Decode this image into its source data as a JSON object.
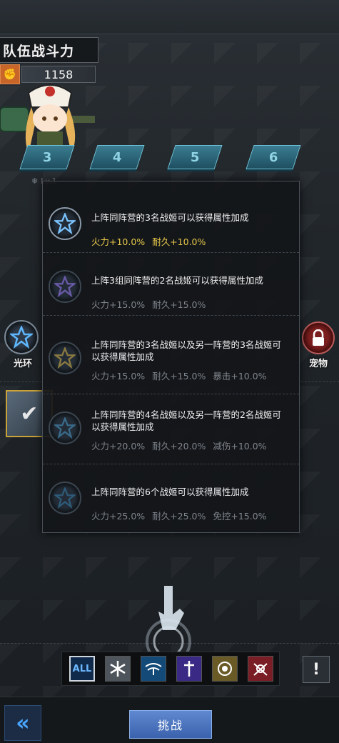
{
  "team": {
    "title": "队伍战斗力",
    "power": "1158"
  },
  "formation": {
    "slots": [
      "3",
      "4",
      "5",
      "6"
    ],
    "level_tag": "Lv.1"
  },
  "aura": {
    "label": "光环"
  },
  "pet": {
    "label": "宠物"
  },
  "popup": {
    "bonuses": [
      {
        "desc": "上阵同阵营的3名战姬可以获得属性加成",
        "stats": [
          "火力+10.0%",
          "耐久+10.0%"
        ],
        "active": true
      },
      {
        "desc": "上阵3组同阵营的2名战姬可以获得属性加成",
        "stats": [
          "火力+15.0%",
          "耐久+15.0%"
        ],
        "active": false
      },
      {
        "desc": "上阵同阵营的3名战姬以及另一阵营的3名战姬可以获得属性加成",
        "stats": [
          "火力+15.0%",
          "耐久+15.0%",
          "暴击+10.0%"
        ],
        "active": false
      },
      {
        "desc": "上阵同阵营的4名战姬以及另一阵营的2名战姬可以获得属性加成",
        "stats": [
          "火力+20.0%",
          "耐久+20.0%",
          "减伤+10.0%"
        ],
        "active": false
      },
      {
        "desc": "上阵同阵营的6个战姬可以获得属性加成",
        "stats": [
          "火力+25.0%",
          "耐久+25.0%",
          "免控+15.0%"
        ],
        "active": false
      }
    ]
  },
  "filters": {
    "all_label": "ALL",
    "info_label": "!"
  },
  "bottom": {
    "back_label": "«",
    "challenge_label": "挑战"
  },
  "colors": {
    "active_stat": "#e6c84a",
    "inactive_stat": "#7f858c",
    "accent_blue": "#4aa6ff"
  }
}
